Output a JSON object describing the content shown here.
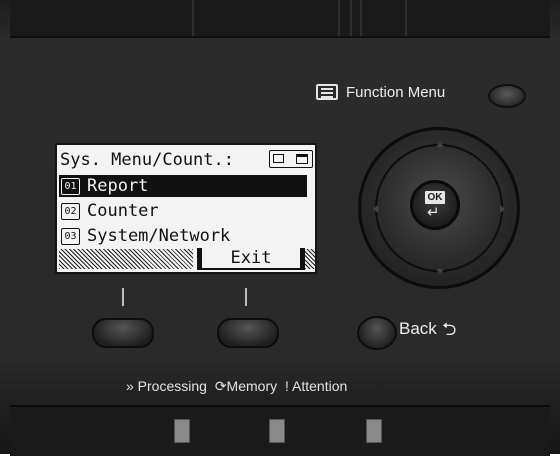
{
  "panel": {
    "function_menu_label": "Function Menu",
    "back_label": "Back",
    "back_symbol": "⮌"
  },
  "lcd": {
    "title": "Sys. Menu/Count.:",
    "items": [
      {
        "num": "01",
        "label": "Report",
        "selected": true
      },
      {
        "num": "02",
        "label": "Counter",
        "selected": false
      },
      {
        "num": "03",
        "label": "System/Network",
        "selected": false
      }
    ],
    "softkey_right": "Exit"
  },
  "ok_button": {
    "label": "OK",
    "symbol": "↵"
  },
  "indicators": {
    "processing": "» Processing",
    "memory": "⟳Memory",
    "attention": "! Attention"
  }
}
